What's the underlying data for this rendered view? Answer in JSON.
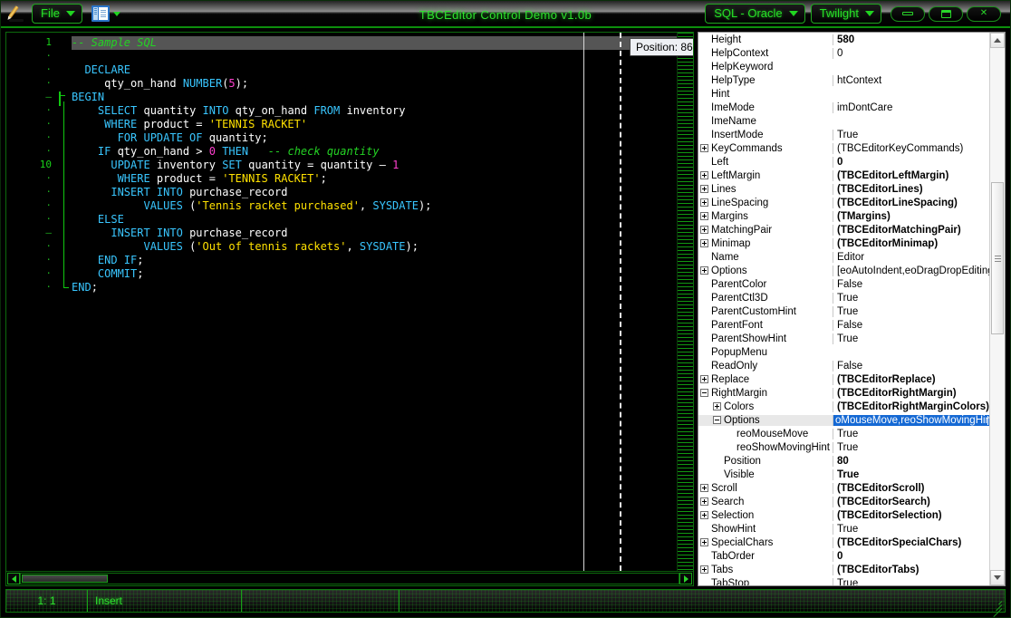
{
  "window": {
    "title": "TBCEditor Control Demo v1.0b",
    "app_icon": "pencil-icon",
    "minimize_label": "—",
    "maximize_label": "□",
    "close_label": "✕"
  },
  "toolbar": {
    "file_label": "File",
    "view_icon": "window-list-icon",
    "highlighter_label": "SQL - Oracle",
    "theme_label": "Twilight"
  },
  "editor": {
    "tooltip": "Position: 86",
    "colors": {
      "background": "#000000",
      "keyword": "#39c6ff",
      "comment": "#24d324",
      "string": "#ffe100",
      "number": "#ff3fcf",
      "plain": "#ffffff",
      "active_line": "#555555",
      "gutter_number": "#1faa1f"
    },
    "lines": [
      {
        "n": "1",
        "big": true,
        "fold": "",
        "active": true,
        "tokens": [
          {
            "t": "-- Sample SQL",
            "c": "cmt"
          }
        ]
      },
      {
        "n": "·",
        "big": false,
        "fold": "",
        "active": false,
        "tokens": []
      },
      {
        "n": "·",
        "big": false,
        "fold": "",
        "active": false,
        "tokens": [
          {
            "t": "  ",
            "c": "pl"
          },
          {
            "t": "DECLARE",
            "c": "kw"
          }
        ]
      },
      {
        "n": "·",
        "big": false,
        "fold": "",
        "active": false,
        "tokens": [
          {
            "t": "     qty_on_hand ",
            "c": "pl"
          },
          {
            "t": "NUMBER",
            "c": "kw"
          },
          {
            "t": "(",
            "c": "pl"
          },
          {
            "t": "5",
            "c": "numlit"
          },
          {
            "t": ");",
            "c": "pl"
          }
        ]
      },
      {
        "n": "–",
        "big": false,
        "fold": "minus",
        "active": false,
        "tokens": [
          {
            "t": "BEGIN",
            "c": "kw"
          }
        ]
      },
      {
        "n": "·",
        "big": false,
        "fold": "",
        "active": false,
        "tokens": [
          {
            "t": "    ",
            "c": "pl"
          },
          {
            "t": "SELECT",
            "c": "kw"
          },
          {
            "t": " quantity ",
            "c": "pl"
          },
          {
            "t": "INTO",
            "c": "kw"
          },
          {
            "t": " qty_on_hand ",
            "c": "pl"
          },
          {
            "t": "FROM",
            "c": "kw"
          },
          {
            "t": " inventory",
            "c": "pl"
          }
        ]
      },
      {
        "n": "·",
        "big": false,
        "fold": "",
        "active": false,
        "tokens": [
          {
            "t": "     ",
            "c": "pl"
          },
          {
            "t": "WHERE",
            "c": "kw"
          },
          {
            "t": " product = ",
            "c": "pl"
          },
          {
            "t": "'TENNIS RACKET'",
            "c": "str"
          }
        ]
      },
      {
        "n": "·",
        "big": false,
        "fold": "",
        "active": false,
        "tokens": [
          {
            "t": "       ",
            "c": "pl"
          },
          {
            "t": "FOR UPDATE OF",
            "c": "kw"
          },
          {
            "t": " quantity;",
            "c": "pl"
          }
        ]
      },
      {
        "n": "·",
        "big": false,
        "fold": "",
        "active": false,
        "tokens": [
          {
            "t": "    ",
            "c": "pl"
          },
          {
            "t": "IF",
            "c": "kw"
          },
          {
            "t": " qty_on_hand > ",
            "c": "pl"
          },
          {
            "t": "0",
            "c": "numlit"
          },
          {
            "t": " ",
            "c": "pl"
          },
          {
            "t": "THEN",
            "c": "kw"
          },
          {
            "t": "   ",
            "c": "pl"
          },
          {
            "t": "-- check quantity",
            "c": "cmt"
          }
        ]
      },
      {
        "n": "10",
        "big": true,
        "fold": "",
        "active": false,
        "tokens": [
          {
            "t": "      ",
            "c": "pl"
          },
          {
            "t": "UPDATE",
            "c": "kw"
          },
          {
            "t": " inventory ",
            "c": "pl"
          },
          {
            "t": "SET",
            "c": "kw"
          },
          {
            "t": " quantity = quantity – ",
            "c": "pl"
          },
          {
            "t": "1",
            "c": "numlit"
          }
        ]
      },
      {
        "n": "·",
        "big": false,
        "fold": "",
        "active": false,
        "tokens": [
          {
            "t": "       ",
            "c": "pl"
          },
          {
            "t": "WHERE",
            "c": "kw"
          },
          {
            "t": " product = ",
            "c": "pl"
          },
          {
            "t": "'TENNIS RACKET'",
            "c": "str"
          },
          {
            "t": ";",
            "c": "pl"
          }
        ]
      },
      {
        "n": "·",
        "big": false,
        "fold": "",
        "active": false,
        "tokens": [
          {
            "t": "      ",
            "c": "pl"
          },
          {
            "t": "INSERT INTO",
            "c": "kw"
          },
          {
            "t": " purchase_record",
            "c": "pl"
          }
        ]
      },
      {
        "n": "·",
        "big": false,
        "fold": "",
        "active": false,
        "tokens": [
          {
            "t": "           ",
            "c": "pl"
          },
          {
            "t": "VALUES",
            "c": "kw"
          },
          {
            "t": " (",
            "c": "pl"
          },
          {
            "t": "'Tennis racket purchased'",
            "c": "str"
          },
          {
            "t": ", ",
            "c": "pl"
          },
          {
            "t": "SYSDATE",
            "c": "kw"
          },
          {
            "t": ");",
            "c": "pl"
          }
        ]
      },
      {
        "n": "·",
        "big": false,
        "fold": "",
        "active": false,
        "tokens": [
          {
            "t": "    ",
            "c": "pl"
          },
          {
            "t": "ELSE",
            "c": "kw"
          }
        ]
      },
      {
        "n": "–",
        "big": false,
        "fold": "",
        "active": false,
        "tokens": [
          {
            "t": "      ",
            "c": "pl"
          },
          {
            "t": "INSERT INTO",
            "c": "kw"
          },
          {
            "t": " purchase_record",
            "c": "pl"
          }
        ]
      },
      {
        "n": "·",
        "big": false,
        "fold": "",
        "active": false,
        "tokens": [
          {
            "t": "           ",
            "c": "pl"
          },
          {
            "t": "VALUES",
            "c": "kw"
          },
          {
            "t": " (",
            "c": "pl"
          },
          {
            "t": "'Out of tennis rackets'",
            "c": "str"
          },
          {
            "t": ", ",
            "c": "pl"
          },
          {
            "t": "SYSDATE",
            "c": "kw"
          },
          {
            "t": ");",
            "c": "pl"
          }
        ]
      },
      {
        "n": "·",
        "big": false,
        "fold": "",
        "active": false,
        "tokens": [
          {
            "t": "    ",
            "c": "pl"
          },
          {
            "t": "END IF",
            "c": "kw"
          },
          {
            "t": ";",
            "c": "pl"
          }
        ]
      },
      {
        "n": "·",
        "big": false,
        "fold": "",
        "active": false,
        "tokens": [
          {
            "t": "    ",
            "c": "pl"
          },
          {
            "t": "COMMIT",
            "c": "kw"
          },
          {
            "t": ";",
            "c": "pl"
          }
        ]
      },
      {
        "n": "·",
        "big": false,
        "fold": "",
        "active": false,
        "tokens": [
          {
            "t": "END",
            "c": "kw"
          },
          {
            "t": ";",
            "c": "pl"
          }
        ]
      }
    ]
  },
  "properties": {
    "selected_value": "oMouseMove,reoShowMovingHint]",
    "rows": [
      {
        "indent": 0,
        "exp": "none",
        "name": "Height",
        "value": "580",
        "bold": true
      },
      {
        "indent": 0,
        "exp": "none",
        "name": "HelpContext",
        "value": "0",
        "bold": false
      },
      {
        "indent": 0,
        "exp": "none",
        "name": "HelpKeyword",
        "value": "",
        "bold": false
      },
      {
        "indent": 0,
        "exp": "none",
        "name": "HelpType",
        "value": "htContext",
        "bold": false
      },
      {
        "indent": 0,
        "exp": "none",
        "name": "Hint",
        "value": "",
        "bold": false
      },
      {
        "indent": 0,
        "exp": "none",
        "name": "ImeMode",
        "value": "imDontCare",
        "bold": false
      },
      {
        "indent": 0,
        "exp": "none",
        "name": "ImeName",
        "value": "",
        "bold": false
      },
      {
        "indent": 0,
        "exp": "none",
        "name": "InsertMode",
        "value": "True",
        "bold": false
      },
      {
        "indent": 0,
        "exp": "plus",
        "name": "KeyCommands",
        "value": "(TBCEditorKeyCommands)",
        "bold": false
      },
      {
        "indent": 0,
        "exp": "none",
        "name": "Left",
        "value": "0",
        "bold": true
      },
      {
        "indent": 0,
        "exp": "plus",
        "name": "LeftMargin",
        "value": "(TBCEditorLeftMargin)",
        "bold": true
      },
      {
        "indent": 0,
        "exp": "plus",
        "name": "Lines",
        "value": "(TBCEditorLines)",
        "bold": true
      },
      {
        "indent": 0,
        "exp": "plus",
        "name": "LineSpacing",
        "value": "(TBCEditorLineSpacing)",
        "bold": true
      },
      {
        "indent": 0,
        "exp": "plus",
        "name": "Margins",
        "value": "(TMargins)",
        "bold": true
      },
      {
        "indent": 0,
        "exp": "plus",
        "name": "MatchingPair",
        "value": "(TBCEditorMatchingPair)",
        "bold": true
      },
      {
        "indent": 0,
        "exp": "plus",
        "name": "Minimap",
        "value": "(TBCEditorMinimap)",
        "bold": true
      },
      {
        "indent": 0,
        "exp": "none",
        "name": "Name",
        "value": "Editor",
        "bold": false
      },
      {
        "indent": 0,
        "exp": "plus",
        "name": "Options",
        "value": "[eoAutoIndent,eoDragDropEditing]",
        "bold": false
      },
      {
        "indent": 0,
        "exp": "none",
        "name": "ParentColor",
        "value": "False",
        "bold": false
      },
      {
        "indent": 0,
        "exp": "none",
        "name": "ParentCtl3D",
        "value": "True",
        "bold": false
      },
      {
        "indent": 0,
        "exp": "none",
        "name": "ParentCustomHint",
        "value": "True",
        "bold": false
      },
      {
        "indent": 0,
        "exp": "none",
        "name": "ParentFont",
        "value": "False",
        "bold": false
      },
      {
        "indent": 0,
        "exp": "none",
        "name": "ParentShowHint",
        "value": "True",
        "bold": false
      },
      {
        "indent": 0,
        "exp": "none",
        "name": "PopupMenu",
        "value": "",
        "bold": false
      },
      {
        "indent": 0,
        "exp": "none",
        "name": "ReadOnly",
        "value": "False",
        "bold": false
      },
      {
        "indent": 0,
        "exp": "plus",
        "name": "Replace",
        "value": "(TBCEditorReplace)",
        "bold": true
      },
      {
        "indent": 0,
        "exp": "minus",
        "name": "RightMargin",
        "value": "(TBCEditorRightMargin)",
        "bold": true
      },
      {
        "indent": 1,
        "exp": "plus",
        "name": "Colors",
        "value": "(TBCEditorRightMarginColors)",
        "bold": true
      },
      {
        "indent": 1,
        "exp": "minus",
        "name": "Options",
        "value": "oMouseMove,reoShowMovingHint]",
        "bold": false,
        "selected": true
      },
      {
        "indent": 2,
        "exp": "none",
        "name": "reoMouseMove",
        "value": "True",
        "bold": false
      },
      {
        "indent": 2,
        "exp": "none",
        "name": "reoShowMovingHint",
        "value": "True",
        "bold": false
      },
      {
        "indent": 1,
        "exp": "none",
        "name": "Position",
        "value": "80",
        "bold": true
      },
      {
        "indent": 1,
        "exp": "none",
        "name": "Visible",
        "value": "True",
        "bold": true
      },
      {
        "indent": 0,
        "exp": "plus",
        "name": "Scroll",
        "value": "(TBCEditorScroll)",
        "bold": true
      },
      {
        "indent": 0,
        "exp": "plus",
        "name": "Search",
        "value": "(TBCEditorSearch)",
        "bold": true
      },
      {
        "indent": 0,
        "exp": "plus",
        "name": "Selection",
        "value": "(TBCEditorSelection)",
        "bold": true
      },
      {
        "indent": 0,
        "exp": "none",
        "name": "ShowHint",
        "value": "True",
        "bold": false
      },
      {
        "indent": 0,
        "exp": "plus",
        "name": "SpecialChars",
        "value": "(TBCEditorSpecialChars)",
        "bold": true
      },
      {
        "indent": 0,
        "exp": "none",
        "name": "TabOrder",
        "value": "0",
        "bold": true
      },
      {
        "indent": 0,
        "exp": "plus",
        "name": "Tabs",
        "value": "(TBCEditorTabs)",
        "bold": true
      },
      {
        "indent": 0,
        "exp": "none",
        "name": "TabStop",
        "value": "True",
        "bold": false
      }
    ]
  },
  "statusbar": {
    "caret": "1: 1",
    "mode": "Insert",
    "cell3": "",
    "cell4": ""
  }
}
